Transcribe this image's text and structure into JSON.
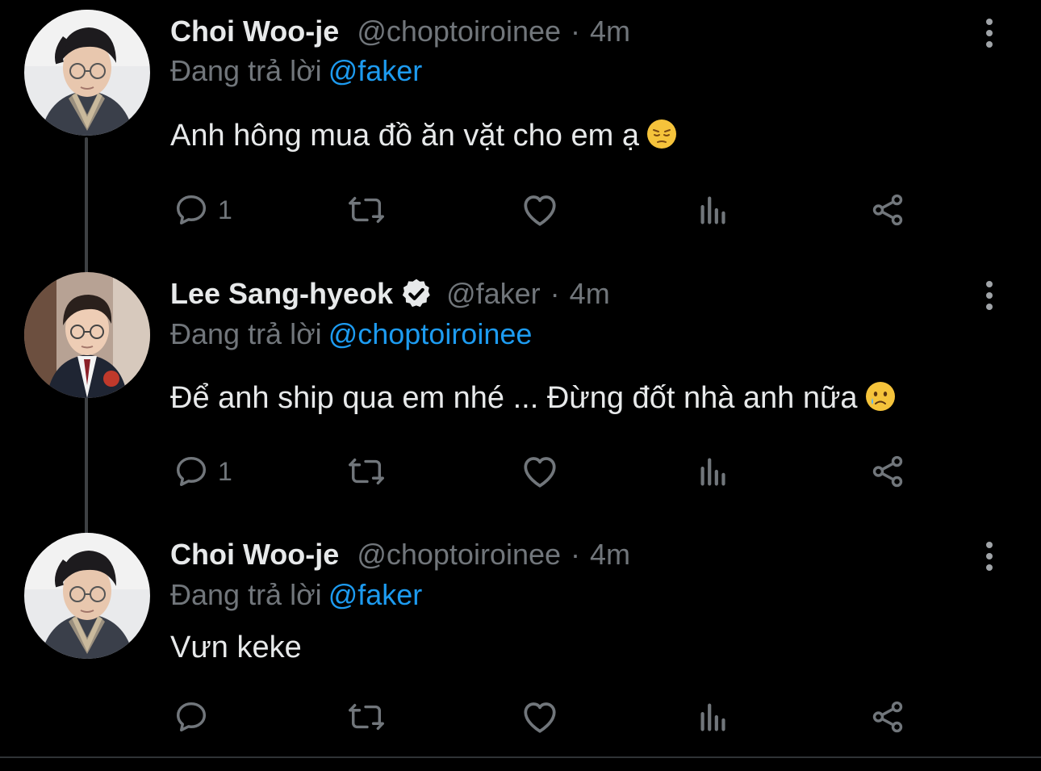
{
  "accent_color": "#1d9bf0",
  "secondary_text_color": "#71767b",
  "tweets": [
    {
      "display_name": "Choi Woo-je",
      "verified": false,
      "handle": "@choptoiroinee",
      "separator": "·",
      "time": "4m",
      "reply_prefix": "Đang trả lời",
      "reply_to": "@faker",
      "text": "Anh hông mua đồ ăn vặt cho em ạ",
      "emoji": "pensive-face",
      "reply_count": "1",
      "avatar_icon": "user-avatar-choi",
      "icons": [
        "reply-icon",
        "retweet-icon",
        "like-icon",
        "views-icon",
        "share-icon",
        "more-options-icon"
      ]
    },
    {
      "display_name": "Lee Sang-hyeok",
      "verified": true,
      "handle": "@faker",
      "separator": "·",
      "time": "4m",
      "reply_prefix": "Đang trả lời",
      "reply_to": "@choptoiroinee",
      "text": "Để anh ship qua em nhé ... Đừng đốt nhà anh nữa",
      "emoji": "crying-face",
      "reply_count": "1",
      "avatar_icon": "user-avatar-lee",
      "icons": [
        "reply-icon",
        "retweet-icon",
        "like-icon",
        "views-icon",
        "share-icon",
        "more-options-icon"
      ]
    },
    {
      "display_name": "Choi Woo-je",
      "verified": false,
      "handle": "@choptoiroinee",
      "separator": "·",
      "time": "4m",
      "reply_prefix": "Đang trả lời",
      "reply_to": "@faker",
      "text": "Vưn keke",
      "emoji": "",
      "reply_count": "",
      "avatar_icon": "user-avatar-choi",
      "icons": [
        "reply-icon",
        "retweet-icon",
        "like-icon",
        "views-icon",
        "share-icon",
        "more-options-icon"
      ]
    }
  ]
}
